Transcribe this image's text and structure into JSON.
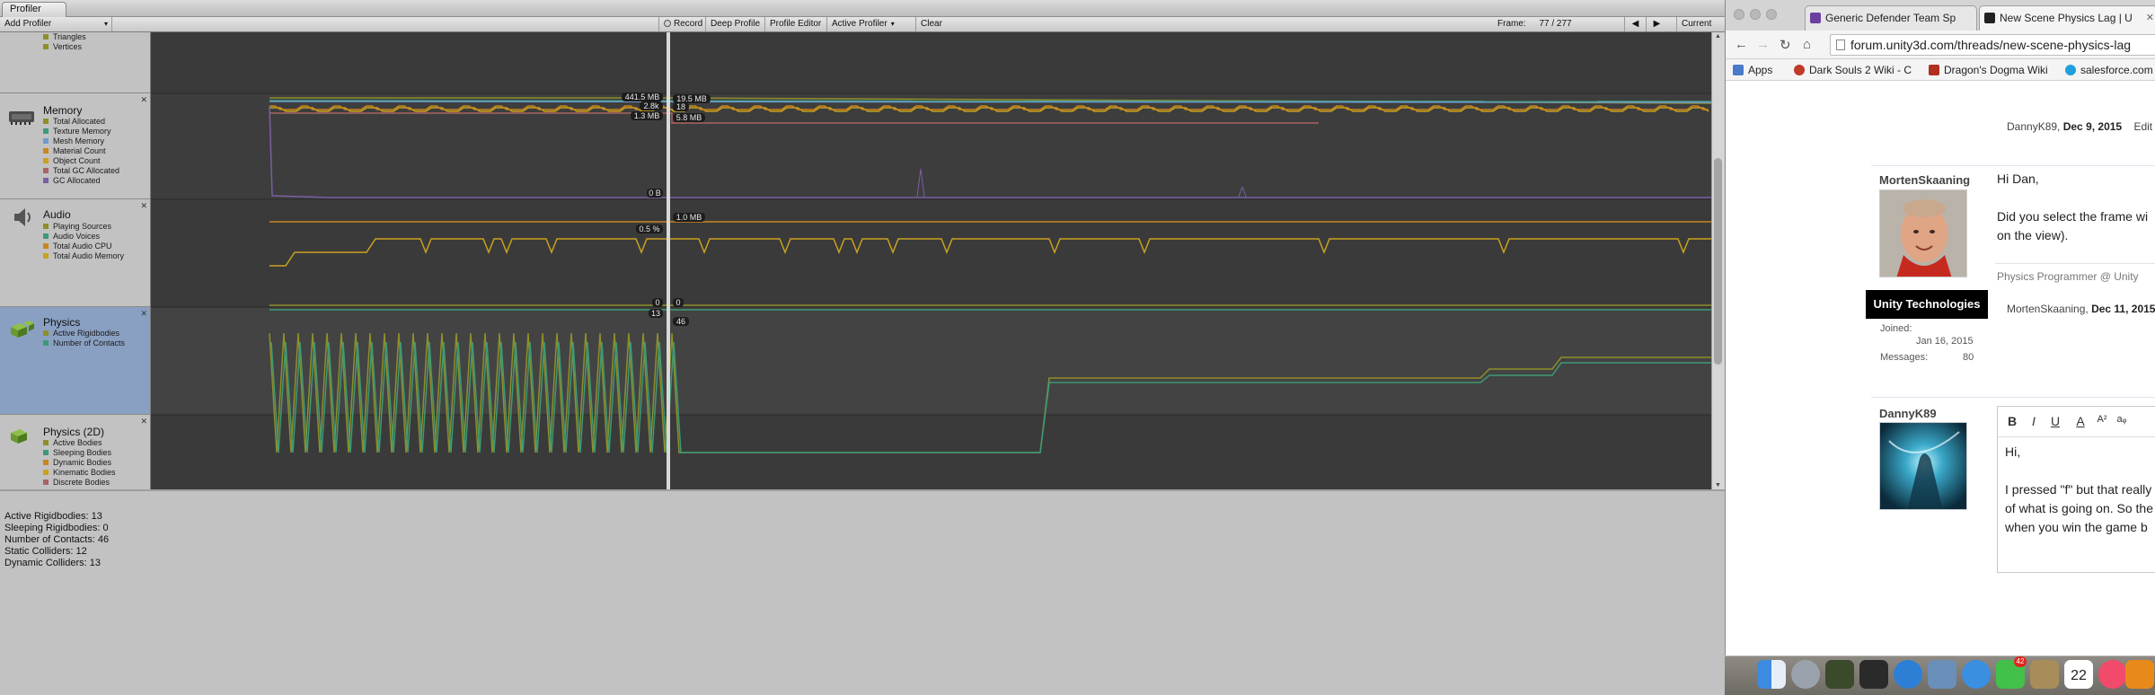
{
  "profiler": {
    "tab_title": "Profiler",
    "toolbar": {
      "add_profiler": "Add Profiler",
      "record": "Record",
      "deep_profile": "Deep Profile",
      "profile_editor": "Profile Editor",
      "active_profiler": "Active Profiler",
      "clear": "Clear",
      "frame_label": "Frame:",
      "frame_value": "77 / 277",
      "current": "Current"
    },
    "areas": {
      "rendering_partial": {
        "legend": [
          "Triangles",
          "Vertices"
        ]
      },
      "memory": {
        "title": "Memory",
        "legend": [
          "Total Allocated",
          "Texture Memory",
          "Mesh Memory",
          "Material Count",
          "Object Count",
          "Total GC Allocated",
          "GC Allocated"
        ],
        "labels_left": [
          "441.5 MB",
          "2.8k",
          "1.3 MB",
          "0 B"
        ],
        "labels_right": [
          "19.5 MB",
          "18",
          "5.8 MB"
        ]
      },
      "audio": {
        "title": "Audio",
        "legend": [
          "Playing Sources",
          "Audio Voices",
          "Total Audio CPU",
          "Total Audio Memory"
        ],
        "labels_left": [
          "0.5 %",
          "0"
        ],
        "labels_right": [
          "1.0 MB",
          "0"
        ]
      },
      "physics": {
        "title": "Physics",
        "legend": [
          "Active Rigidbodies",
          "Number of Contacts"
        ],
        "labels_left": [
          "13"
        ],
        "labels_right": [
          "46"
        ]
      },
      "physics2d": {
        "title": "Physics (2D)",
        "legend": [
          "Active Bodies",
          "Sleeping Bodies",
          "Dynamic Bodies",
          "Kinematic Bodies",
          "Discrete Bodies"
        ]
      }
    },
    "stats": [
      "Active Rigidbodies: 13",
      "Sleeping Rigidbodies: 0",
      "Number of Contacts: 46",
      "Static Colliders: 12",
      "Dynamic Colliders: 13"
    ],
    "colors": {
      "graph_bg": "#3d3d3d",
      "legend": [
        "#8f8f2a",
        "#3d9a75",
        "#6d9bd0",
        "#c9851f",
        "#c9a21f",
        "#a86565",
        "#7a5fa3"
      ]
    }
  },
  "browser": {
    "tabs": [
      {
        "title": "Generic Defender Team Sp",
        "favicon_color": "#6b3fa0"
      },
      {
        "title": "New Scene Physics Lag | U",
        "favicon_color": "#222222"
      }
    ],
    "url": "forum.unity3d.com/threads/new-scene-physics-lag",
    "bookmarks": [
      {
        "label": "Apps",
        "icon_color": "#4a7ac9"
      },
      {
        "label": "Dark Souls 2 Wiki - C",
        "icon_color": "#c0392b"
      },
      {
        "label": "Dragon's Dogma Wiki",
        "icon_color": "#b03020"
      },
      {
        "label": "salesforce.com",
        "icon_color": "#1fa0dc"
      }
    ],
    "posts": {
      "prev_meta": {
        "author": "DannyK89",
        "date": "Dec 9, 2015",
        "action": "Edit"
      },
      "reply1": {
        "username": "MortenSkaaning",
        "badge": "Unity Technologies",
        "joined_label": "Joined:",
        "joined_value": "Jan 16, 2015",
        "messages_label": "Messages:",
        "messages_value": "80",
        "greeting": "Hi Dan,",
        "line1": "Did you select the frame wi",
        "line2": "on the view).",
        "signature": "Physics Programmer @ Unity",
        "meta_author": "MortenSkaaning",
        "meta_date": "Dec 11, 2015"
      },
      "reply2": {
        "username": "DannyK89",
        "greeting": "Hi,",
        "line1": "I pressed \"f\" but that really",
        "line2": "of what is going on. So the",
        "line3": "when you win the game b"
      }
    },
    "editor_buttons": [
      "B",
      "I",
      "U",
      "A",
      "A²",
      "aᵩ"
    ]
  },
  "dock": {
    "calendar_day": "22",
    "messages_badge": "42"
  }
}
